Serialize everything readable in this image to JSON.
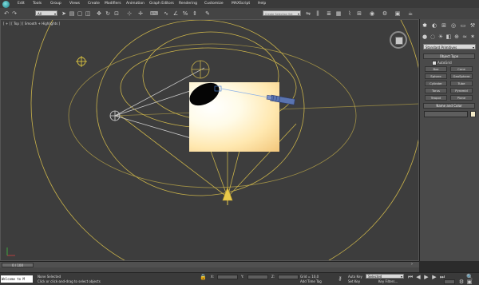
{
  "menu": [
    "Edit",
    "Tools",
    "Group",
    "Views",
    "Create",
    "Modifiers",
    "Animation",
    "Graph Editors",
    "Rendering",
    "Customize",
    "MAXScript",
    "Help"
  ],
  "toolbar": {
    "selection_filter": "All",
    "named_selection": "Create Selection Set"
  },
  "viewport": {
    "label": "[ + ] [ Top ] [ Smooth + Highlights ]"
  },
  "command_panel": {
    "primitives_dropdown": "Standard Primitives",
    "object_type_title": "Object Type",
    "autogrid_label": "AutoGrid",
    "buttons": [
      "Box",
      "Cone",
      "Sphere",
      "GeoSphere",
      "Cylinder",
      "Tube",
      "Torus",
      "Pyramid",
      "Teapot",
      "Plane"
    ],
    "name_color_title": "Name and Color"
  },
  "timeline": {
    "frame_label": "0 / 100"
  },
  "status": {
    "welcome": "Welcome to M",
    "none_selected": "None Selected",
    "prompt": "Click or click-and-drag to select objects",
    "grid": "Grid = 10,0",
    "add_time_tag": "Add Time Tag",
    "auto_key": "Auto Key",
    "set_key": "Set Key",
    "key_mode_value": "Selected",
    "key_filters": "Key Filters..."
  },
  "colors": {
    "gizmo_yellow": "#c9b24a",
    "light_yellow": "#e8c94a",
    "highlight_red": "#c43a3a"
  }
}
